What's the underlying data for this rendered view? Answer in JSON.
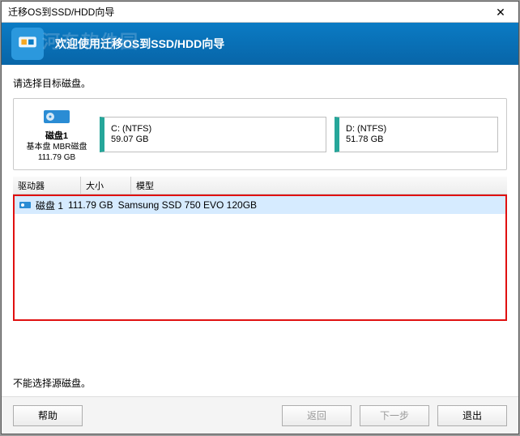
{
  "titlebar": {
    "title": "迁移OS到SSD/HDD向导"
  },
  "banner": {
    "text": "欢迎使用迁移OS到SSD/HDD向导"
  },
  "prompt": "请选择目标磁盘。",
  "source_disk": {
    "name": "磁盘1",
    "type": "基本盘 MBR磁盘",
    "size": "111.79 GB",
    "partitions": [
      {
        "label": "C: (NTFS)",
        "size": "59.07 GB"
      },
      {
        "label": "D: (NTFS)",
        "size": "51.78 GB"
      }
    ]
  },
  "list": {
    "headers": {
      "drive": "驱动器",
      "size": "大小",
      "model": "模型"
    },
    "row": {
      "drive": "磁盘 1",
      "size": "111.79 GB",
      "model": "Samsung SSD 750 EVO 120GB"
    }
  },
  "note": "不能选择源磁盘。",
  "buttons": {
    "help": "帮助",
    "back": "返回",
    "next": "下一步",
    "exit": "退出"
  }
}
